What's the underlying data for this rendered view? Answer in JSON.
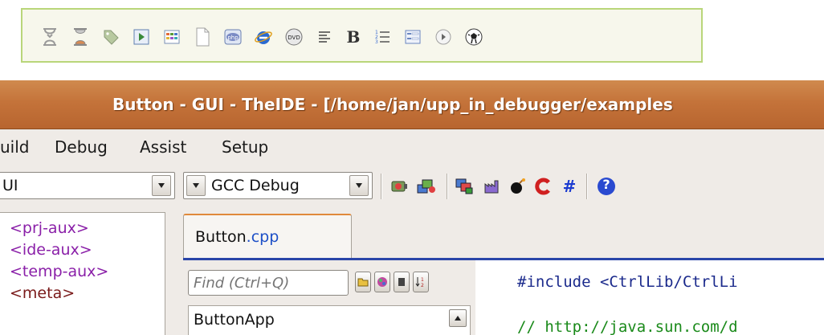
{
  "icon_strip": {
    "icons": [
      "hourglass-empty-icon",
      "hourglass-icon",
      "tag-icon",
      "play-frame-icon",
      "grid-icon",
      "document-icon",
      "php-icon",
      "internet-explorer-icon",
      "dvd-icon",
      "align-left-icon",
      "bold-icon",
      "numbered-list-icon",
      "form-icon",
      "play-circle-icon",
      "soccer-ball-icon"
    ],
    "bold_glyph": "B"
  },
  "window": {
    "title": "Button - GUI - TheIDE - [/home/jan/upp_in_debugger/examples"
  },
  "menu": {
    "items": [
      "uild",
      "Debug",
      "Assist",
      "Setup"
    ]
  },
  "toolbar": {
    "main_package_value": "UI",
    "build_method_value": "GCC Debug",
    "help_glyph": "?",
    "hash_glyph": "#",
    "icons": [
      "build-icon",
      "rebuild-icon",
      "clean-icon",
      "export-icon",
      "debug-bomb-icon",
      "run-c-icon",
      "hash-icon",
      "help-icon"
    ]
  },
  "packages": {
    "items": [
      {
        "label": "<prj-aux>",
        "color": "#8a1fa8"
      },
      {
        "label": "<ide-aux>",
        "color": "#8a1fa8"
      },
      {
        "label": "<temp-aux>",
        "color": "#8a1fa8"
      },
      {
        "label": "<meta>",
        "color": "#7a1a1a"
      }
    ]
  },
  "tabs": {
    "active": {
      "name": "Button",
      "ext": ".cpp"
    }
  },
  "navigator": {
    "search_placeholder": "Find (Ctrl+Q)",
    "items": [
      "ButtonApp"
    ]
  },
  "editor": {
    "lines": [
      {
        "text": "#include <CtrlLib/CtrlLi",
        "kind": "include"
      },
      {
        "text": "// http://java.sun.com/d",
        "kind": "comment"
      }
    ]
  },
  "colors": {
    "title_bar": "#c4733a",
    "strip_border": "#b9d67a",
    "tab_accent": "#e0893a",
    "editor_rule": "#2a45a8"
  }
}
